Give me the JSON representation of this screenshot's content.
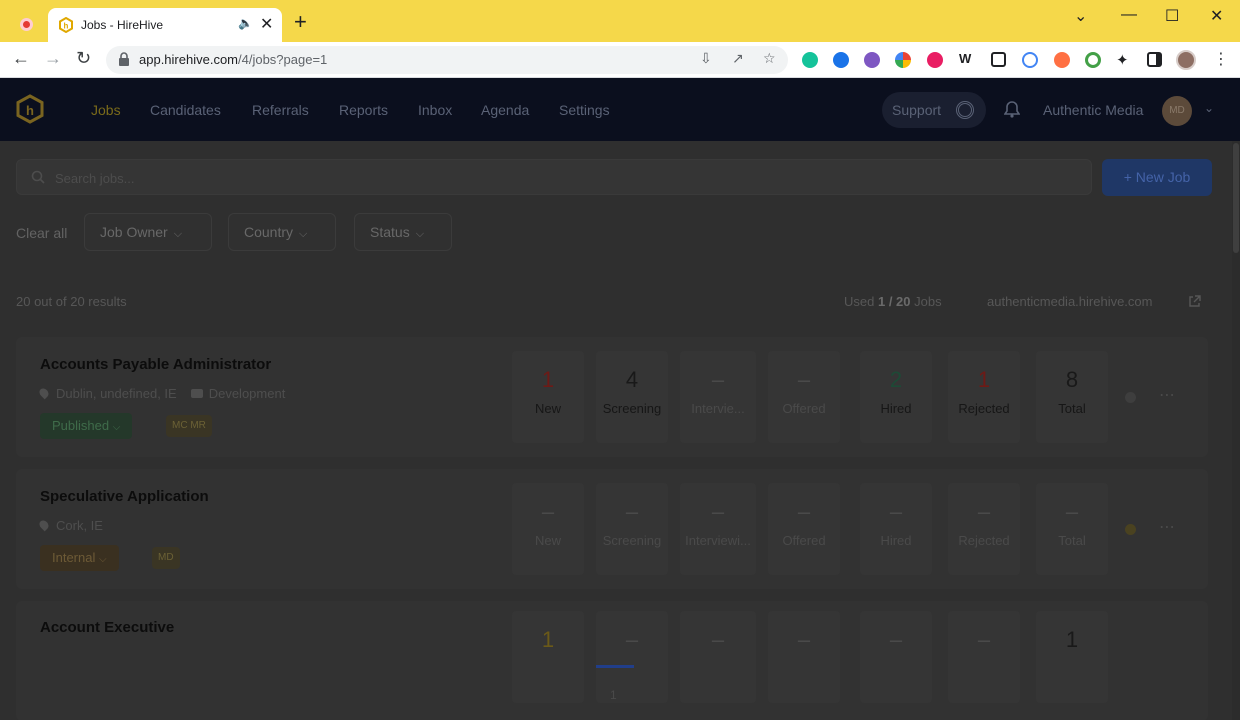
{
  "browser": {
    "tab_title": "Jobs - HireHive",
    "tab_audio_icon": "speaker-icon",
    "url_host": "app.hirehive.com",
    "url_path": "/4/jobs?page=1",
    "tabbar_color": "#f5d84a"
  },
  "app": {
    "nav": [
      "Jobs",
      "Candidates",
      "Referrals",
      "Reports",
      "Inbox",
      "Agenda",
      "Settings"
    ],
    "active_nav": "Jobs",
    "support_label": "Support",
    "org_name": "Authentic Media",
    "avatar_initials": "MD"
  },
  "toolbar": {
    "search_placeholder": "Search jobs...",
    "new_job_label": "New Job",
    "new_job_icon": "+"
  },
  "filters": {
    "clear_all": "Clear all",
    "items": [
      "Job Owner",
      "Country",
      "Status"
    ]
  },
  "summary": {
    "results": "20 out of 20 results",
    "used_prefix": "Used",
    "used_count": "1 / 20",
    "used_suffix": "Jobs",
    "site": "authenticmedia.hirehive.com"
  },
  "stat_labels": [
    "New",
    "Screening",
    "Interviewing",
    "Offered",
    "Hired",
    "Rejected",
    "Total"
  ],
  "jobs": [
    {
      "title": "Accounts Payable Administrator",
      "location": "Dublin, undefined, IE",
      "department": "Development",
      "status": "Published",
      "owners": "MC MR",
      "labels": [
        "New",
        "Screening",
        "Intervie...",
        "Offered",
        "Hired",
        "Rejected",
        "Total"
      ],
      "stats": [
        "1",
        "4",
        "–",
        "–",
        "2",
        "1",
        "8"
      ]
    },
    {
      "title": "Speculative Application",
      "location": "Cork, IE",
      "status": "Internal",
      "owners": "MD",
      "labels": [
        "New",
        "Screening",
        "Interviewi...",
        "Offered",
        "Hired",
        "Rejected",
        "Total"
      ],
      "stats": [
        "–",
        "–",
        "–",
        "–",
        "–",
        "–",
        "–"
      ]
    },
    {
      "title": "Account Executive",
      "stats": [
        "1",
        "–",
        "–",
        "–",
        "–",
        "–",
        "1"
      ]
    }
  ],
  "pagination": {
    "current_page": "1"
  }
}
